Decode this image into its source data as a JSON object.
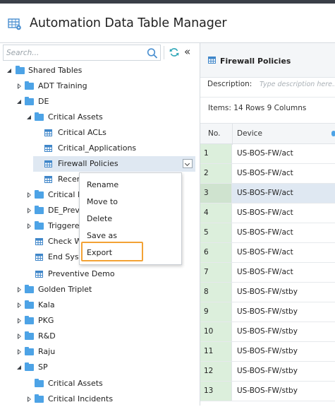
{
  "app": {
    "title": "Automation Data Table Manager"
  },
  "search": {
    "placeholder": "Search..."
  },
  "tree": [
    {
      "label": "Shared Tables"
    },
    {
      "label": "ADT Training"
    },
    {
      "label": "DE"
    },
    {
      "label": "Critical Assets"
    },
    {
      "label": "Critical ACLs"
    },
    {
      "label": "Critical_Applications"
    },
    {
      "label": "Firewall Policies"
    },
    {
      "label": "Recen"
    },
    {
      "label": "Critical I"
    },
    {
      "label": "DE_Prev"
    },
    {
      "label": "Triggere"
    },
    {
      "label": "Check W"
    },
    {
      "label": "End Syst"
    },
    {
      "label": "Preventive Demo"
    },
    {
      "label": "Golden Triplet"
    },
    {
      "label": "Kala"
    },
    {
      "label": "PKG"
    },
    {
      "label": "R&D"
    },
    {
      "label": "Raju"
    },
    {
      "label": "SP"
    },
    {
      "label": "Critical Assets"
    },
    {
      "label": "Critical Incidents"
    }
  ],
  "context_menu": {
    "items": [
      "Rename",
      "Move to",
      "Delete",
      "Save as",
      "Export"
    ],
    "highlighted": "Export"
  },
  "detail": {
    "title": "Firewall Policies",
    "description_label": "Description:",
    "description_placeholder": "Type description here...",
    "items_label": "Items:",
    "rows_text": "14 Rows",
    "columns_text": "9 Columns",
    "columns": [
      "No.",
      "Device"
    ],
    "rows": [
      {
        "no": "1",
        "device": "US-BOS-FW/act"
      },
      {
        "no": "2",
        "device": "US-BOS-FW/act"
      },
      {
        "no": "3",
        "device": "US-BOS-FW/act"
      },
      {
        "no": "4",
        "device": "US-BOS-FW/act"
      },
      {
        "no": "5",
        "device": "US-BOS-FW/act"
      },
      {
        "no": "6",
        "device": "US-BOS-FW/act"
      },
      {
        "no": "7",
        "device": "US-BOS-FW/act"
      },
      {
        "no": "8",
        "device": "US-BOS-FW/stby"
      },
      {
        "no": "9",
        "device": "US-BOS-FW/stby"
      },
      {
        "no": "10",
        "device": "US-BOS-FW/stby"
      },
      {
        "no": "11",
        "device": "US-BOS-FW/stby"
      },
      {
        "no": "12",
        "device": "US-BOS-FW/stby"
      },
      {
        "no": "13",
        "device": "US-BOS-FW/stby"
      }
    ]
  },
  "colors": {
    "accent": "#4da3e6",
    "highlight_border": "#f3a235",
    "selection": "#dfe8f2",
    "row_number_bg": "#dcefdc"
  }
}
